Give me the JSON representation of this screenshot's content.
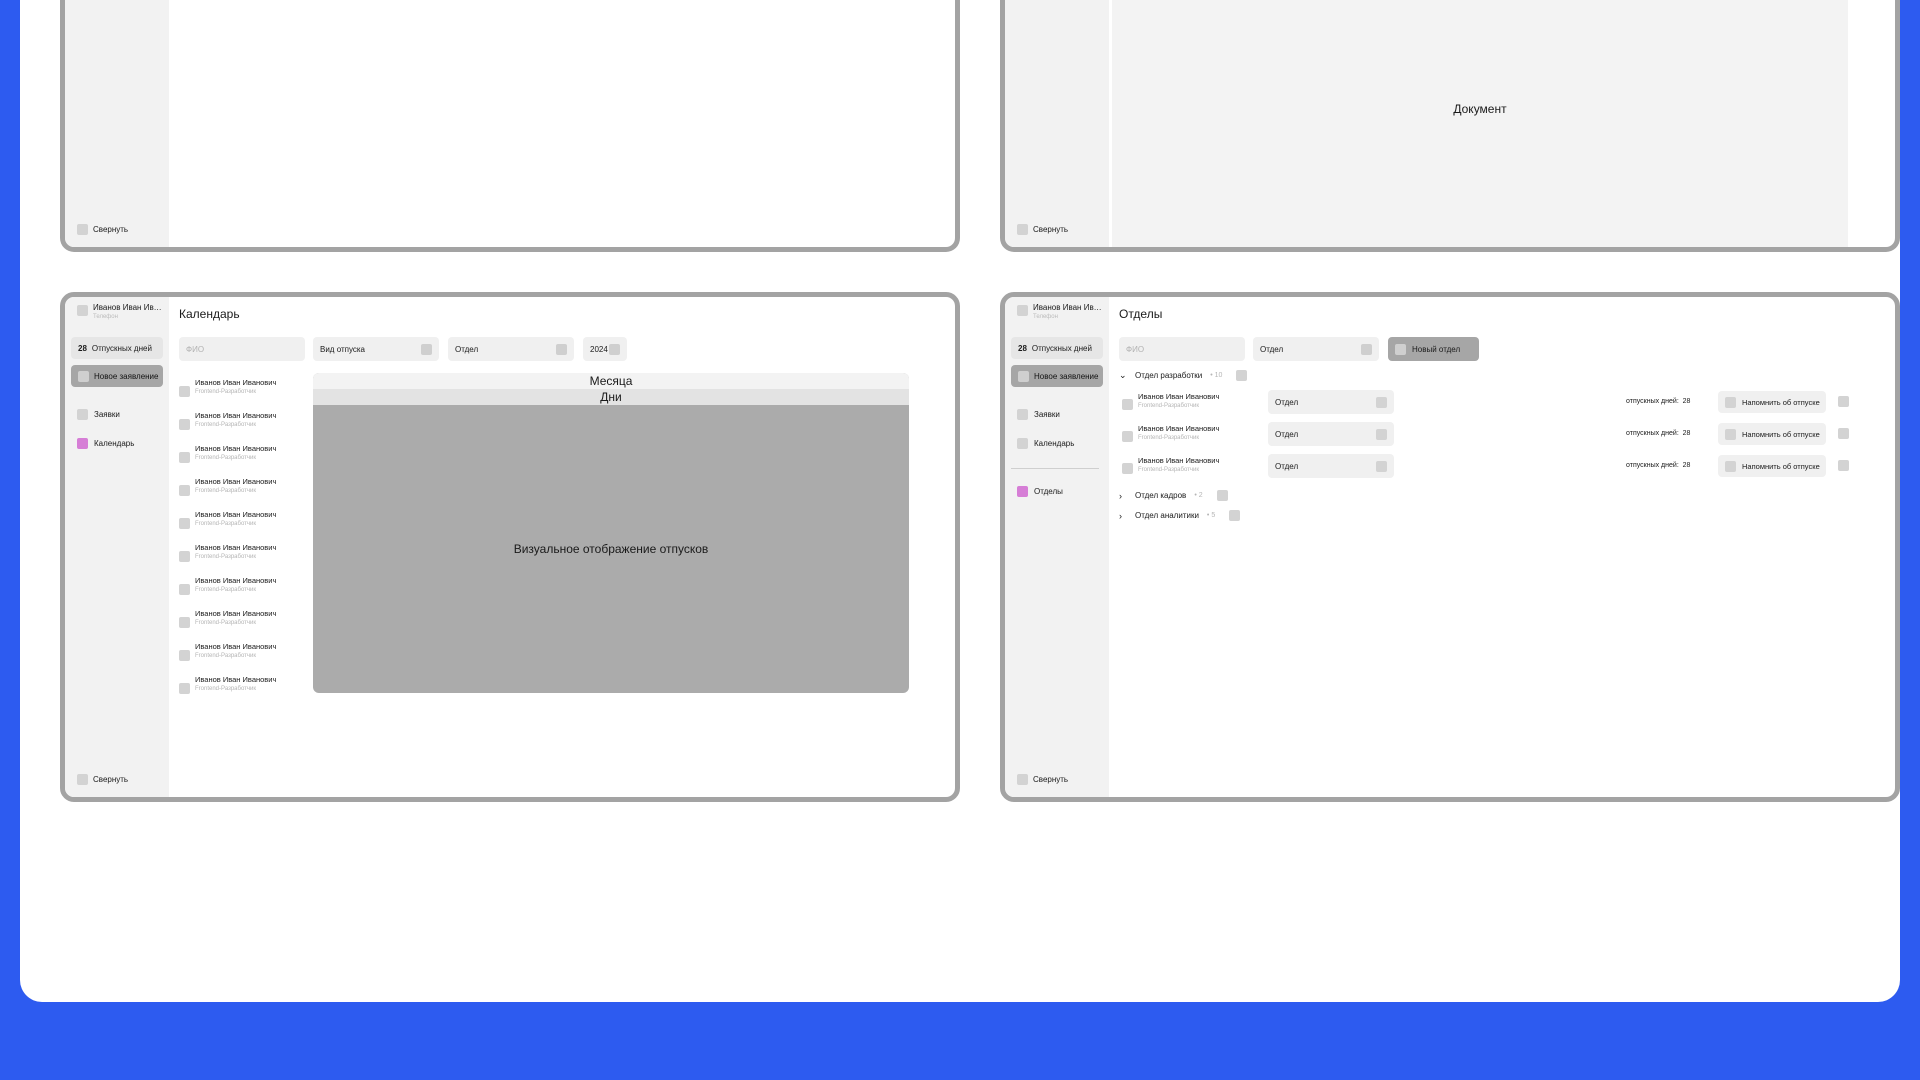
{
  "common": {
    "collapse_label": "Свернуть",
    "user": {
      "name": "Иванов Иван Иванович",
      "phone": "Телефон"
    },
    "vacation_days_count": "28",
    "vacation_days_label": "Отпускных дней",
    "new_request_label": "Новое заявление",
    "nav": {
      "requests": "Заявки",
      "calendar": "Календарь",
      "departments": "Отделы"
    }
  },
  "document_frame": {
    "document_label": "Документ"
  },
  "calendar_frame": {
    "title": "Календарь",
    "filters": {
      "name_placeholder": "ФИО",
      "vacation_type": "Вид отпуска",
      "department": "Отдел",
      "year": "2024"
    },
    "employees": [
      {
        "name": "Иванов Иван Иванович",
        "role": "Frontend-Разработчик"
      },
      {
        "name": "Иванов Иван Иванович",
        "role": "Frontend-Разработчик"
      },
      {
        "name": "Иванов Иван Иванович",
        "role": "Frontend-Разработчик"
      },
      {
        "name": "Иванов Иван Иванович",
        "role": "Frontend-Разработчик"
      },
      {
        "name": "Иванов Иван Иванович",
        "role": "Frontend-Разработчик"
      },
      {
        "name": "Иванов Иван Иванович",
        "role": "Frontend-Разработчик"
      },
      {
        "name": "Иванов Иван Иванович",
        "role": "Frontend-Разработчик"
      },
      {
        "name": "Иванов Иван Иванович",
        "role": "Frontend-Разработчик"
      },
      {
        "name": "Иванов Иван Иванович",
        "role": "Frontend-Разработчик"
      },
      {
        "name": "Иванов Иван Иванович",
        "role": "Frontend-Разработчик"
      }
    ],
    "viz": {
      "months_label": "Месяца",
      "days_label": "Дни",
      "placeholder": "Визуальное отображение отпусков"
    }
  },
  "departments_frame": {
    "title": "Отделы",
    "filters": {
      "name_placeholder": "ФИО",
      "department": "Отдел",
      "new_department_button": "Новый отдел"
    },
    "groups": [
      {
        "name": "Отдел разработки",
        "count": "10",
        "expanded": true
      },
      {
        "name": "Отдел кадров",
        "count": "2",
        "expanded": false
      },
      {
        "name": "Отдел аналитики",
        "count": "5",
        "expanded": false
      }
    ],
    "rows": [
      {
        "name": "Иванов Иван Иванович",
        "role": "Frontend-Разработчик",
        "department": "Отдел",
        "vacation_label": "отпускных дней:",
        "vacation_days": "28",
        "remind_label": "Напомнить об отпуске"
      },
      {
        "name": "Иванов Иван Иванович",
        "role": "Frontend-Разработчик",
        "department": "Отдел",
        "vacation_label": "отпускных дней:",
        "vacation_days": "28",
        "remind_label": "Напомнить об отпуске"
      },
      {
        "name": "Иванов Иван Иванович",
        "role": "Frontend-Разработчик",
        "department": "Отдел",
        "vacation_label": "отпускных дней:",
        "vacation_days": "28",
        "remind_label": "Напомнить об отпуске"
      }
    ],
    "icons": {
      "expanded": "chevron-down-icon",
      "collapsed": "chevron-right-icon"
    }
  },
  "colors": {
    "background": "#2d5bf0",
    "active_nav": "#d67ed6",
    "frame_border": "#a3a3a3"
  }
}
